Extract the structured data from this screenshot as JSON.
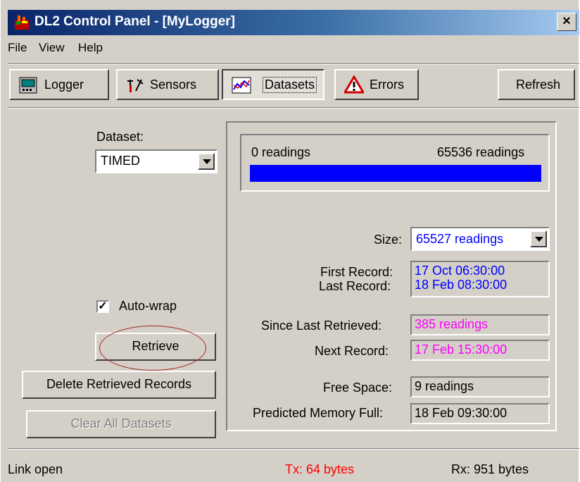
{
  "window": {
    "title": "DL2 Control Panel - [MyLogger]",
    "close_label": "×"
  },
  "menu": [
    "File",
    "View",
    "Help"
  ],
  "toolbar": {
    "logger": "Logger",
    "sensors": "Sensors",
    "datasets": "Datasets",
    "errors": "Errors",
    "refresh": "Refresh"
  },
  "dataset": {
    "label": "Dataset:",
    "selected": "TIMED"
  },
  "options": {
    "autowrap_label": "Auto-wrap",
    "autowrap_checked": true
  },
  "buttons": {
    "retrieve": "Retrieve",
    "delete_retrieved": "Delete Retrieved Records",
    "clear_all": "Clear All Datasets"
  },
  "progress": {
    "min_label": "0 readings",
    "max_label": "65536 readings",
    "fill_fraction": 1.0
  },
  "info": {
    "size_label": "Size:",
    "size_value": "65527 readings",
    "first_record_label": "First Record:",
    "first_record_value": "17 Oct 06:30:00",
    "last_record_label": "Last Record:",
    "last_record_value": "18 Feb 08:30:00",
    "since_last_label": "Since Last Retrieved:",
    "since_last_value": "385 readings",
    "next_record_label": "Next Record:",
    "next_record_value": "17 Feb 15:30:00",
    "free_space_label": "Free Space:",
    "free_space_value": "9 readings",
    "predicted_full_label": "Predicted Memory Full:",
    "predicted_full_value": "18 Feb 09:30:00"
  },
  "status": {
    "link": "Link open",
    "tx": "Tx: 64 bytes",
    "rx": "Rx: 951 bytes"
  },
  "colors": {
    "blue_value": "#0000ff",
    "magenta_value": "#ff00ff",
    "tx_red": "#ff0000",
    "progress_blue": "#0000ff",
    "annotation": "#a52a2a"
  }
}
